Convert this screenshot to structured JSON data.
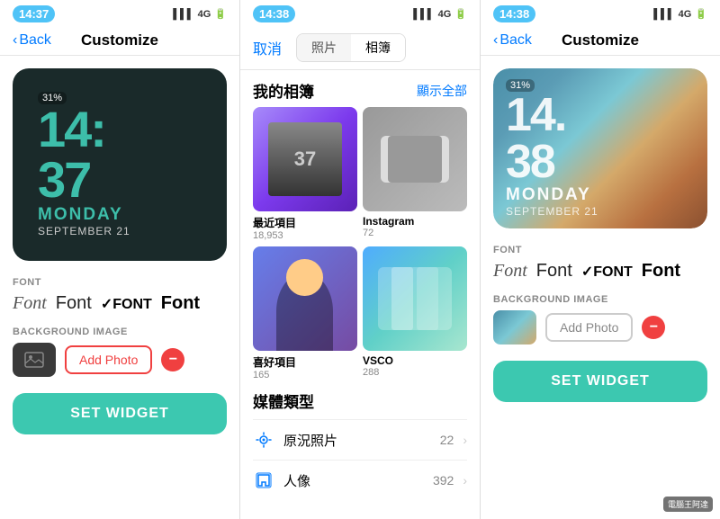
{
  "left_phone": {
    "status_time": "14:37",
    "nav_back": "Back",
    "nav_title": "Customize",
    "battery": "31%",
    "widget_time": "14:37",
    "widget_time_display": "14:\n37",
    "widget_day": "MONDAY",
    "widget_date": "SEPTEMBER 21",
    "font_section": "FONT",
    "fonts": [
      {
        "label": "Font",
        "style": "cursive",
        "id": "cursive"
      },
      {
        "label": "Font",
        "style": "normal",
        "id": "normal"
      },
      {
        "label": "✓FONT",
        "style": "bold-caps",
        "id": "bold-caps"
      },
      {
        "label": "Font",
        "style": "bold",
        "id": "bold"
      }
    ],
    "bg_section": "BACKGROUND IMAGE",
    "add_photo": "Add Photo",
    "set_widget": "SET WIDGET"
  },
  "middle_phone": {
    "status_time": "14:38",
    "cancel": "取消",
    "tabs": [
      "照片",
      "相簿"
    ],
    "active_tab": "相簿",
    "albums_title": "我的相簿",
    "show_all": "顯示全部",
    "albums": [
      {
        "name": "最近項目",
        "count": "18,953"
      },
      {
        "name": "Instagram",
        "count": "72"
      },
      {
        "name": "喜好項目",
        "count": "165"
      },
      {
        "name": "VSCO",
        "count": "288"
      }
    ],
    "media_types_title": "媒體類型",
    "media_types": [
      {
        "name": "原況照片",
        "count": "22",
        "icon": "live-photo"
      },
      {
        "name": "人像",
        "count": "392",
        "icon": "cube"
      }
    ]
  },
  "right_phone": {
    "status_time": "14:38",
    "nav_back": "Back",
    "nav_title": "Customize",
    "battery": "31%",
    "widget_time_h": "14.",
    "widget_time_m": "38",
    "widget_day": "MONDAY",
    "widget_date": "SEPTEMBER 21",
    "font_section": "FONT",
    "fonts": [
      {
        "label": "Font",
        "style": "cursive",
        "id": "cursive"
      },
      {
        "label": "Font",
        "style": "normal",
        "id": "normal"
      },
      {
        "label": "✓FONT",
        "style": "bold-caps",
        "id": "bold-caps"
      },
      {
        "label": "Font",
        "style": "bold",
        "id": "bold"
      }
    ],
    "bg_section": "BACKGROUND IMAGE",
    "add_photo": "Add Photo",
    "set_widget": "SET WIDGET"
  },
  "watermark": "電腦王阿達",
  "colors": {
    "teal": "#3cc8b0",
    "red": "#f04040",
    "blue": "#007aff"
  }
}
